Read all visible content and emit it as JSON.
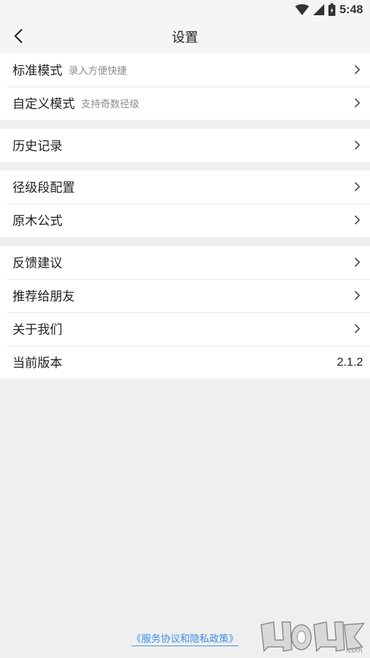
{
  "status_bar": {
    "time": "5:48"
  },
  "header": {
    "title": "设置"
  },
  "groups": [
    {
      "items": [
        {
          "label": "标准模式",
          "sub": "录入方便快捷"
        },
        {
          "label": "自定义模式",
          "sub": "支持奇数径级"
        }
      ]
    },
    {
      "items": [
        {
          "label": "历史记录"
        }
      ]
    },
    {
      "items": [
        {
          "label": "径级段配置"
        },
        {
          "label": "原木公式"
        }
      ]
    },
    {
      "items": [
        {
          "label": "反馈建议"
        },
        {
          "label": "推荐给朋友"
        },
        {
          "label": "关于我们"
        },
        {
          "label": "当前版本",
          "value": "2.1.2"
        }
      ]
    }
  ],
  "footer": {
    "policy_link": "《服务协议和隐私政策》"
  },
  "watermark": {
    "text": "9K9K.com"
  },
  "colors": {
    "link": "#3a90e6",
    "background": "#efefef"
  }
}
